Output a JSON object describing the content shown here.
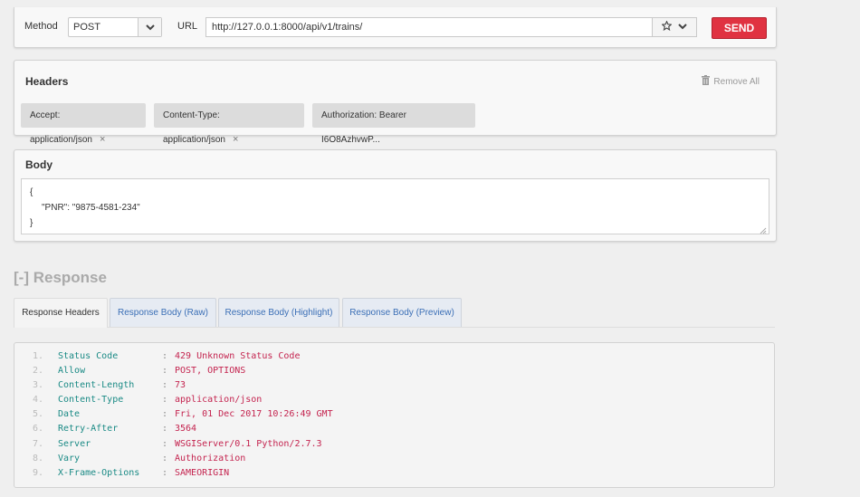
{
  "request": {
    "method_label": "Method",
    "method_value": "POST",
    "url_label": "URL",
    "url_value": "http://127.0.0.1:8000/api/v1/trains/",
    "send_label": "SEND"
  },
  "headers_panel": {
    "title": "Headers",
    "remove_all_label": "Remove All",
    "chips": [
      {
        "label": "Accept: application/json",
        "close": "×"
      },
      {
        "label": "Content-Type: application/json",
        "close": "×"
      },
      {
        "label": "Authorization: Bearer I6O8AzhvwP..."
      }
    ]
  },
  "body_panel": {
    "title": "Body",
    "lines": [
      "{",
      "\"PNR\": \"9875-4581-234\"",
      "}"
    ]
  },
  "response": {
    "title": "[-] Response",
    "tabs": [
      "Response Headers",
      "Response Body (Raw)",
      "Response Body (Highlight)",
      "Response Body (Preview)"
    ],
    "active_tab_index": 0,
    "rows": [
      {
        "num": "1.",
        "key": "Status Code",
        "value": "429 Unknown Status Code"
      },
      {
        "num": "2.",
        "key": "Allow",
        "value": "POST, OPTIONS"
      },
      {
        "num": "3.",
        "key": "Content-Length",
        "value": "73"
      },
      {
        "num": "4.",
        "key": "Content-Type",
        "value": "application/json"
      },
      {
        "num": "5.",
        "key": "Date",
        "value": "Fri, 01 Dec 2017 10:26:49 GMT"
      },
      {
        "num": "6.",
        "key": "Retry-After",
        "value": "3564"
      },
      {
        "num": "7.",
        "key": "Server",
        "value": "WSGIServer/0.1 Python/2.7.3"
      },
      {
        "num": "8.",
        "key": "Vary",
        "value": "Authorization"
      },
      {
        "num": "9.",
        "key": "X-Frame-Options",
        "value": "SAMEORIGIN"
      }
    ]
  },
  "colors": {
    "send_button": "#e03241",
    "header_key": "#1a8a85",
    "header_value": "#c4244f",
    "tab_text": "#3b6fb6"
  },
  "icons": [
    "chevron-down-icon",
    "star-icon",
    "trash-icon",
    "close-icon",
    "resize-grip-icon"
  ]
}
